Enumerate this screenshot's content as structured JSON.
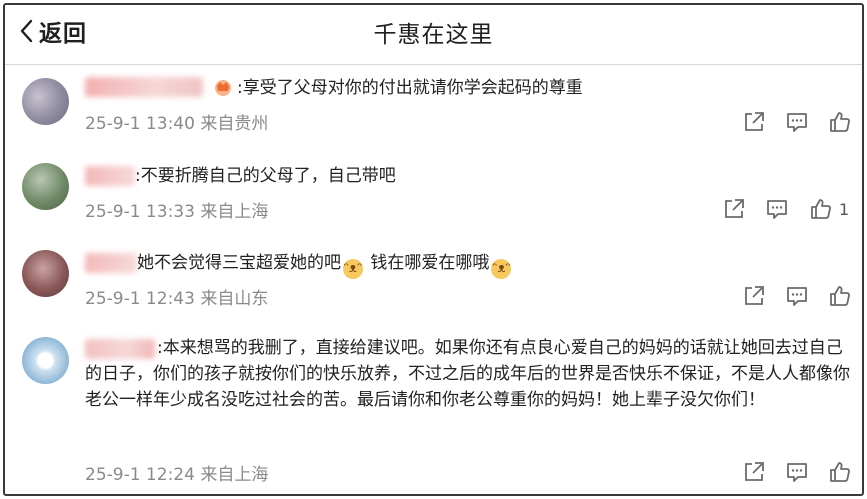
{
  "nav": {
    "back_label": "返回",
    "title": "千惠在这里"
  },
  "comments": [
    {
      "text": ":享受了父母对你的付出就请你学会起码的尊重",
      "time": "25-9-1 13:40",
      "location": "来自贵州",
      "likes": ""
    },
    {
      "text": ":不要折腾自己的父母了，自己带吧",
      "time": "25-9-1 13:33",
      "location": "来自上海",
      "likes": "1"
    },
    {
      "text_part1": "她不会觉得三宝超爱她的吧",
      "text_part2": " 钱在哪爱在哪哦",
      "time": "25-9-1 12:43",
      "location": "来自山东",
      "likes": ""
    },
    {
      "text": ":本来想骂的我删了，直接给建议吧。如果你还有点良心爱自己的妈妈的话就让她回去过自己的日子，你们的孩子就按你们的快乐放养，不过之后的成年后的世界是否快乐不保证，不是人人都像你老公一样年少成名没吃过社会的苦。最后请你和你老公尊重你的妈妈！她上辈子没欠你们！",
      "time": "25-9-1 12:24",
      "location": "来自上海",
      "likes": ""
    }
  ],
  "colors": {
    "meta_gray": "#8a8a8a",
    "icon_gray": "#6b6b6b",
    "divider": "#d9d9d9"
  },
  "icons": [
    "chevron-left-icon",
    "share-icon",
    "comment-icon",
    "like-icon",
    "crown-badge-icon",
    "cat-emoji-icon"
  ]
}
